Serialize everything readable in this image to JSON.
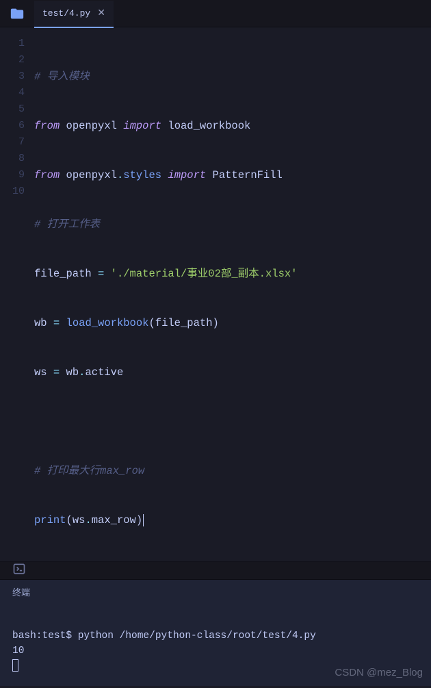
{
  "tab": {
    "filename": "test/4.py",
    "close_glyph": "✕"
  },
  "gutter": [
    "1",
    "2",
    "3",
    "4",
    "5",
    "6",
    "7",
    "8",
    "9",
    "10"
  ],
  "code": {
    "l1_comment": "# 导入模块",
    "l2": {
      "from": "from",
      "mod": "openpyxl",
      "import": "import",
      "name": "load_workbook"
    },
    "l3": {
      "from": "from",
      "mod": "openpyxl",
      "dot": ".",
      "sub": "styles",
      "import": "import",
      "name": "PatternFill"
    },
    "l4_comment": "# 打开工作表",
    "l5": {
      "var": "file_path",
      "eq": "=",
      "str": "'./material/事业02部_副本.xlsx'"
    },
    "l6": {
      "var": "wb",
      "eq": "=",
      "fn": "load_workbook",
      "lp": "(",
      "arg": "file_path",
      "rp": ")"
    },
    "l7": {
      "var": "ws",
      "eq": "=",
      "obj": "wb",
      "dot": ".",
      "attr": "active"
    },
    "l9_comment": "# 打印最大行max_row",
    "l10": {
      "fn": "print",
      "lp": "(",
      "obj": "ws",
      "dot": ".",
      "attr": "max_row",
      "rp": ")"
    }
  },
  "panel": {
    "terminal_label": "终端"
  },
  "terminal": {
    "prompt": "bash:test$ ",
    "command": "python /home/python-class/root/test/4.py",
    "output": "10"
  },
  "watermark": "CSDN @mez_Blog"
}
